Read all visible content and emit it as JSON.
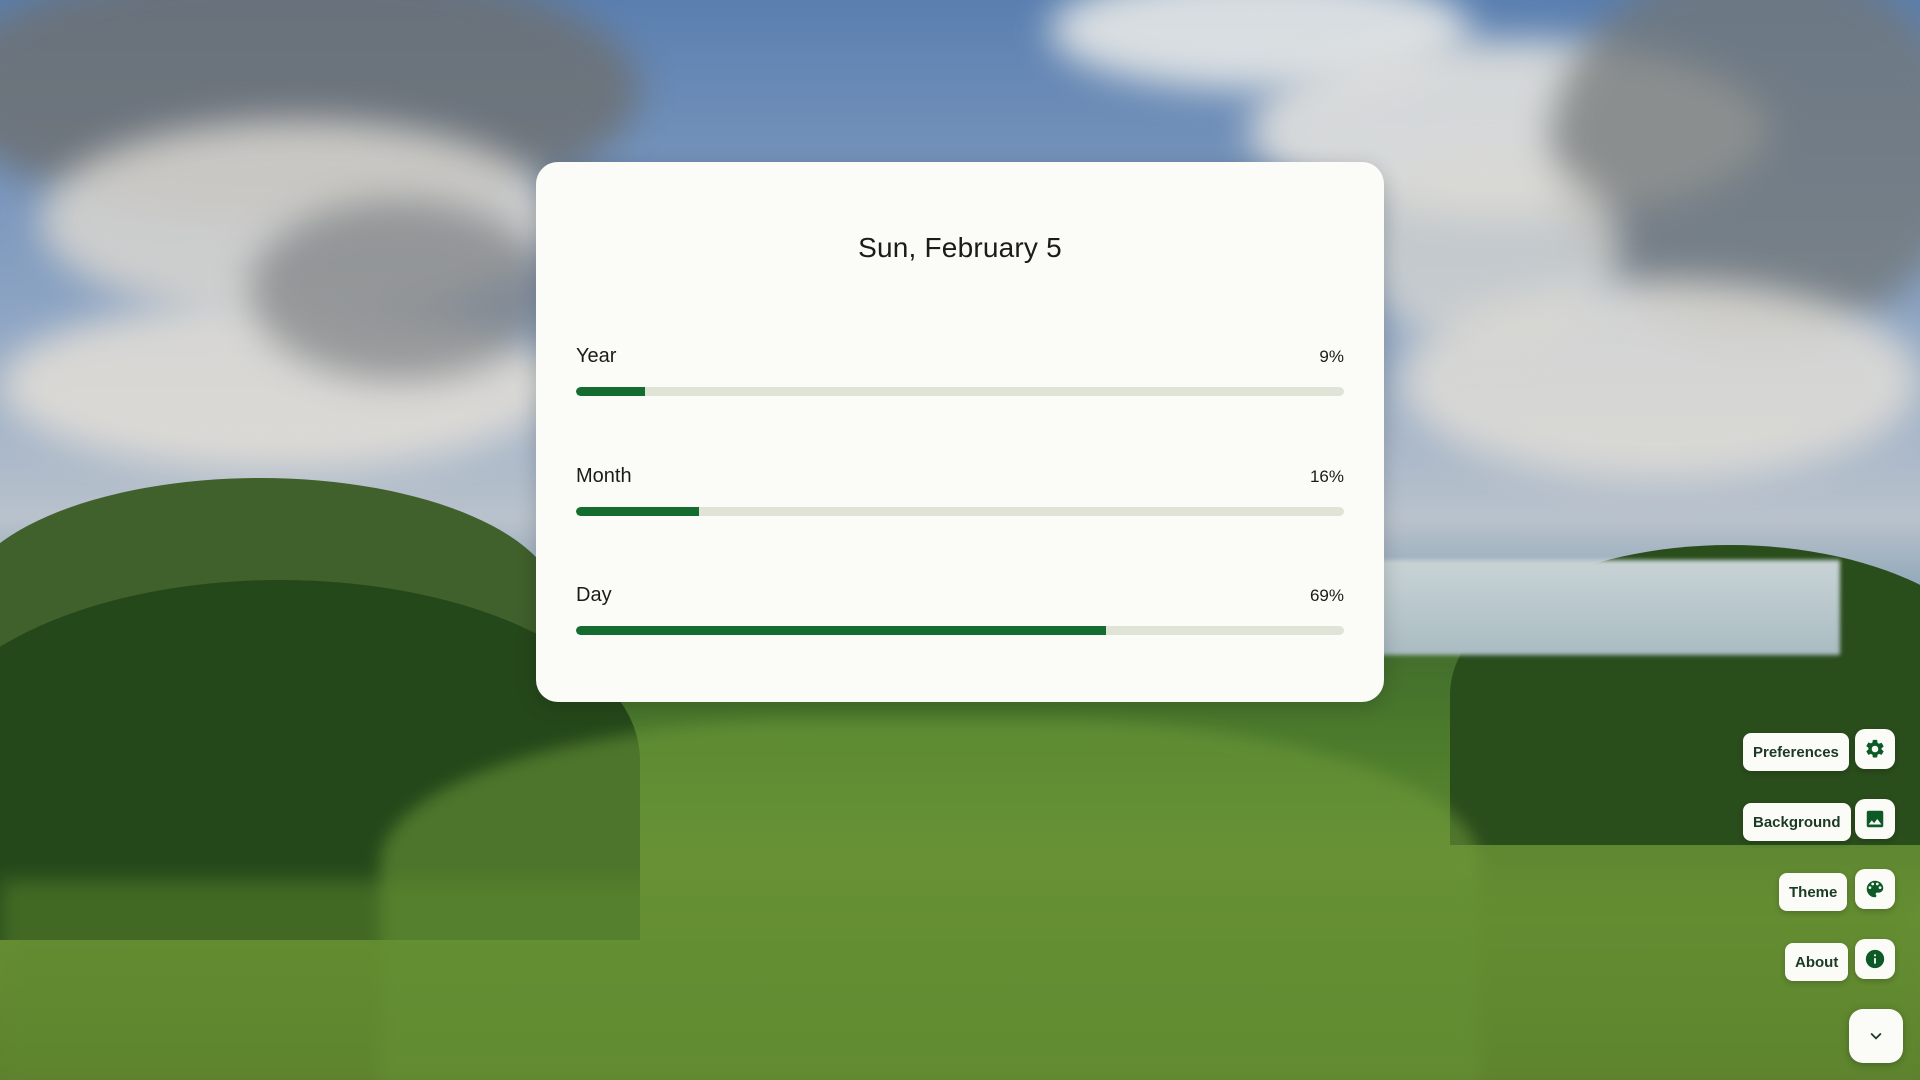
{
  "date": "Sun, February 5",
  "progress": [
    {
      "label": "Year",
      "percent_text": "9%",
      "value": 0.09
    },
    {
      "label": "Month",
      "percent_text": "16%",
      "value": 0.16
    },
    {
      "label": "Day",
      "percent_text": "69%",
      "value": 0.69
    }
  ],
  "menu": [
    {
      "label": "Preferences",
      "icon": "gear-icon"
    },
    {
      "label": "Background",
      "icon": "image-icon"
    },
    {
      "label": "Theme",
      "icon": "palette-icon"
    },
    {
      "label": "About",
      "icon": "info-icon"
    }
  ],
  "colors": {
    "accent": "#146c2e",
    "track": "#dfe4d7",
    "card": "#fbfcf7",
    "icon": "#0d5a26"
  }
}
